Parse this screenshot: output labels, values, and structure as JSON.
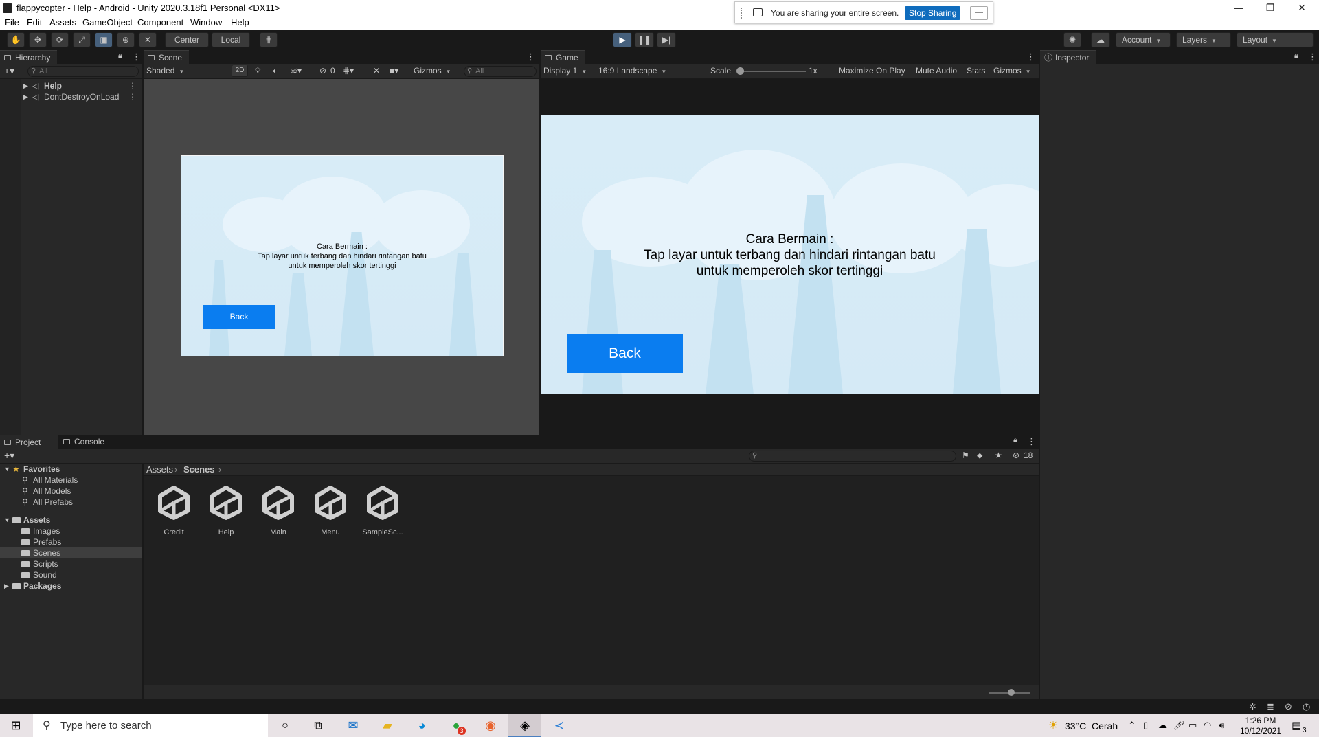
{
  "window": {
    "title": "flappycopter - Help - Android - Unity 2020.3.18f1 Personal <DX11>",
    "min": "—",
    "max": "❐",
    "close": "✕"
  },
  "menu": [
    "File",
    "Edit",
    "Assets",
    "GameObject",
    "Component",
    "Window",
    "Help"
  ],
  "share": {
    "message": "You are sharing your entire screen.",
    "stop_label": "Stop Sharing",
    "min_label": "—"
  },
  "toolbar": {
    "pivot_center": "Center",
    "pivot_local": "Local",
    "account": "Account",
    "layers": "Layers",
    "layout": "Layout"
  },
  "hierarchy": {
    "tab": "Hierarchy",
    "search_placeholder": "All",
    "items": [
      "Help",
      "DontDestroyOnLoad"
    ]
  },
  "scene": {
    "tab": "Scene",
    "shading": "Shaded",
    "mode_2d": "2D",
    "hidden_count": "0",
    "gizmos": "Gizmos",
    "search_placeholder": "All"
  },
  "game": {
    "tab": "Game",
    "display": "Display 1",
    "aspect": "16:9 Landscape",
    "scale_label": "Scale",
    "scale_value": "1x",
    "maximize": "Maximize On Play",
    "mute": "Mute Audio",
    "stats": "Stats",
    "gizmos": "Gizmos"
  },
  "content": {
    "heading": "Cara Bermain  :",
    "line1": "Tap layar untuk terbang dan hindari rintangan batu",
    "line2": "untuk memperoleh skor tertinggi",
    "back": "Back"
  },
  "inspector": {
    "tab": "Inspector"
  },
  "project": {
    "tab_project": "Project",
    "tab_console": "Console",
    "hidden_count": "18",
    "favorites": "Favorites",
    "favorite_items": [
      "All Materials",
      "All Models",
      "All Prefabs"
    ],
    "assets": "Assets",
    "asset_folders": [
      "Images",
      "Prefabs",
      "Scenes",
      "Scripts",
      "Sound"
    ],
    "packages": "Packages",
    "breadcrumb": [
      "Assets",
      "Scenes"
    ],
    "scenes": [
      "Credit",
      "Help",
      "Main",
      "Menu",
      "SampleSc..."
    ]
  },
  "taskbar": {
    "search_placeholder": "Type here to search",
    "weather_temp": "33°C",
    "weather_text": "Cerah",
    "time": "1:26 PM",
    "date": "10/12/2021",
    "notification_count": "3",
    "badge_count": "3"
  },
  "colors": {
    "accent_blue": "#0a7df0",
    "sky": "#d8ecf7",
    "panel": "#282828",
    "active_tool": "#46607c"
  }
}
